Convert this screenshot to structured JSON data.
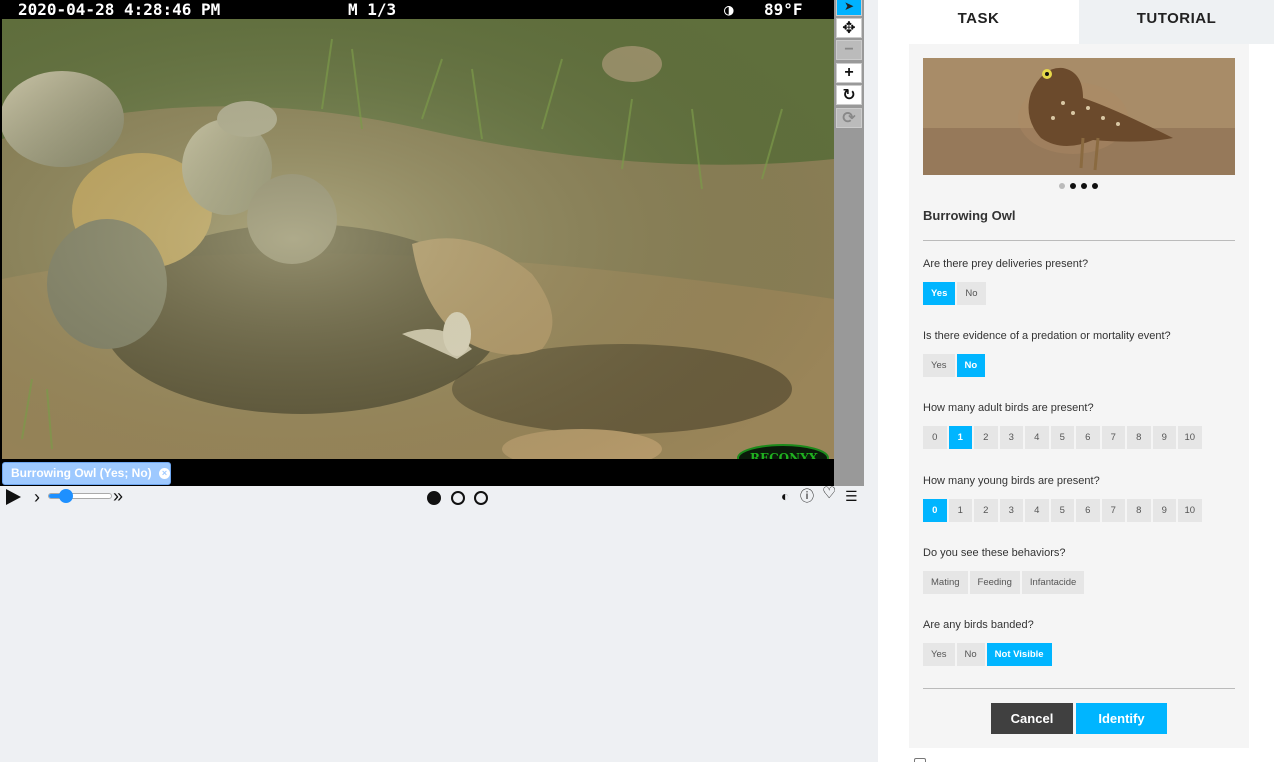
{
  "camera": {
    "datetime": "2020-04-28 4:28:46 PM",
    "frame": "M 1/3",
    "temperature": "89°F",
    "brand": "RECONYX"
  },
  "annotation_tag": {
    "label": "Burrowing Owl (Yes; No)",
    "remove_glyph": "×"
  },
  "toolbar": {
    "tools": [
      {
        "name": "pointer-icon",
        "glyph": "➤"
      },
      {
        "name": "move-icon",
        "glyph": "✥"
      },
      {
        "name": "zoom-out-icon",
        "glyph": "−"
      },
      {
        "name": "zoom-in-icon",
        "glyph": "+"
      },
      {
        "name": "rotate-icon",
        "glyph": "↻"
      },
      {
        "name": "reset-icon",
        "glyph": "⟳"
      }
    ]
  },
  "playback": {
    "play_glyph": "▶",
    "step_glyph": "›",
    "fast_glyph": "»",
    "speed_level": 0.2,
    "frames_total": 3,
    "frame_current": 1,
    "icons": {
      "contrast": "◐",
      "info": "ⓘ",
      "favorite": "♡",
      "list": "☰"
    }
  },
  "panel": {
    "tabs": [
      "TASK",
      "TUTORIAL"
    ],
    "active_tab": "TASK",
    "species": "Burrowing Owl",
    "hero_dots_total": 4,
    "hero_dot_active": 0,
    "questions": [
      {
        "text": "Are there prey deliveries present?",
        "options": [
          "Yes",
          "No"
        ],
        "selected": [
          "Yes"
        ]
      },
      {
        "text": "Is there evidence of a predation or mortality event?",
        "options": [
          "Yes",
          "No"
        ],
        "selected": [
          "No"
        ]
      },
      {
        "text": "How many adult birds are present?",
        "options": [
          "0",
          "1",
          "2",
          "3",
          "4",
          "5",
          "6",
          "7",
          "8",
          "9",
          "10"
        ],
        "selected": [
          "1"
        ]
      },
      {
        "text": "How many young birds are present?",
        "options": [
          "0",
          "1",
          "2",
          "3",
          "4",
          "5",
          "6",
          "7",
          "8",
          "9",
          "10"
        ],
        "selected": [
          "0"
        ]
      },
      {
        "text": "Do you see these behaviors?",
        "options": [
          "Mating",
          "Feeding",
          "Infantacide"
        ],
        "selected": []
      },
      {
        "text": "Are any birds banded?",
        "options": [
          "Yes",
          "No",
          "Not Visible"
        ],
        "selected": [
          "Not Visible"
        ]
      }
    ],
    "cancel_label": "Cancel",
    "identify_label": "Identify"
  },
  "colors": {
    "accent": "#00b5ff",
    "tag": "#9ec9ff",
    "cancel": "#404040"
  }
}
